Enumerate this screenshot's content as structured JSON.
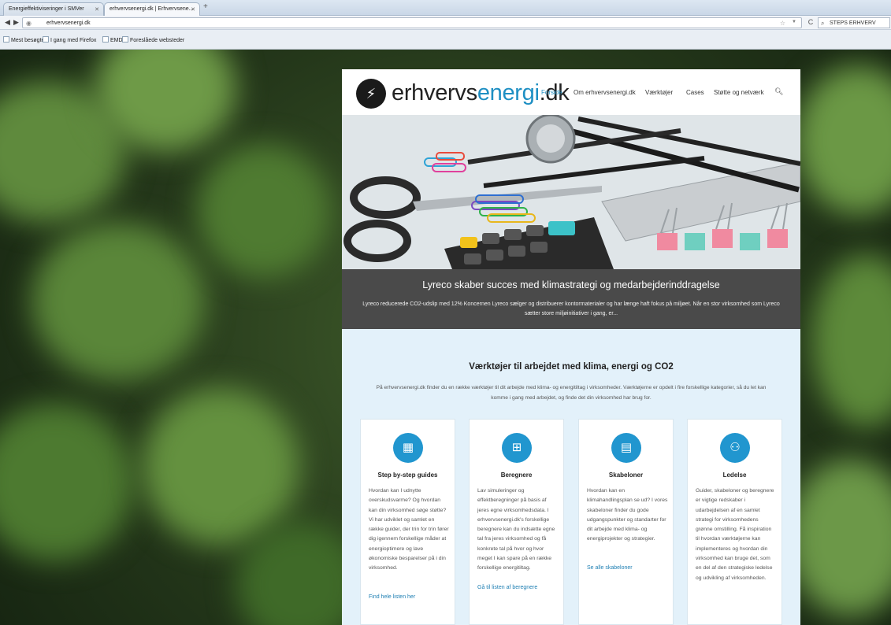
{
  "browser": {
    "tabs": [
      {
        "label": "Energieffektiviseringer i SMVer"
      },
      {
        "label": "erhvervsenergi.dk | Erhvervsene..."
      }
    ],
    "new_tab": "+",
    "url": "erhvervsenergi.dk",
    "search_text": "STEPS ERHVERV",
    "bookmarks": [
      "Mest besøgte",
      "I gang med Firefox",
      "EMD",
      "Foreslåede websteder"
    ]
  },
  "site": {
    "logo_prefix": "erhvervs",
    "logo_accent": "energi",
    "logo_suffix": ".dk",
    "nav": [
      "Forside",
      "Om erhvervsenergi.dk",
      "Værktøjer",
      "Cases",
      "Støtte og netværk"
    ]
  },
  "hero": {
    "title": "Lyreco skaber succes med klimastrategi og medarbejderinddragelse",
    "text": "Lyreco reducerede CO2-udslip med 12% Koncernen Lyreco sælger og distribuerer kontormaterialer og har længe haft fokus på miljøet. Når en stor virksomhed som Lyreco sætter store miljøinitiativer i gang, er..."
  },
  "tools": {
    "heading": "Værktøjer til arbejdet med klima, energi og CO2",
    "intro": "På erhvervsenergi.dk finder du en række værktøjer til dit arbejde med klima- og energitiltag i virksomheder. Værktøjerne er opdelt i fire forskellige kategorier, så du let kan komme i gang med arbejdet, og finde det din virksomhed har brug for.",
    "cards": [
      {
        "title": "Step by-step guides",
        "text": "Hvordan kan I udnytte overskudsvarme? Og hvordan kan din virksomhed søge støtte? Vi har udviklet og samlet en række guider, der trin for trin fører dig igennem forskellige måder at energioptimere og lave økonomiske besparelser på i din virksomhed.",
        "link": "Find hele listen her"
      },
      {
        "title": "Beregnere",
        "text": "Lav simuleringer og effektberegninger på basis af jeres egne virksomhedsdata. I erhvervsenergi.dk's forskellige beregnere kan du indsætte egne tal fra jeres virksomhed og få konkrete tal på hvor og hvor meget I kan spare på en række forskellige energitiltag.",
        "link": "Gå til listen af beregnere"
      },
      {
        "title": "Skabeloner",
        "text": "Hvordan kan en klimahandlingsplan se ud? I vores skabeloner finder du gode udgangspunkter og standarter for dit arbejde med klima- og energiprojekter og strategier.",
        "link": "Se alle skabeloner"
      },
      {
        "title": "Ledelse",
        "text": "Guider, skabeloner og beregnere er vigtige redskaber i udarbejdelsen af en samlet strategi for virksomhedens grønne omstilling. Få inspiration til hvordan værktøjerne kan implementeres og hvordan din virksomhed kan bruge det, som en del af den strategiske ledelse og udvikling af virksomheden."
      }
    ]
  }
}
